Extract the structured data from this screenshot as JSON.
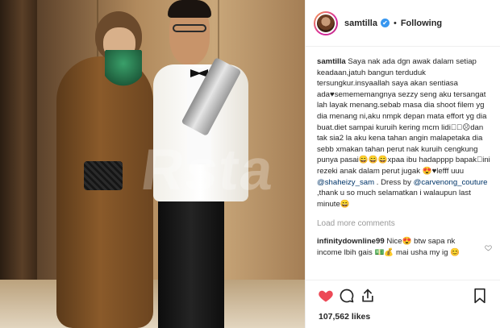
{
  "photo": {
    "watermark": "Rsta"
  },
  "header": {
    "username": "samtilla",
    "verified_mark": "✔",
    "separator": "•",
    "follow_label": "Following"
  },
  "caption": {
    "username": "samtilla",
    "text_before_mention": "Saya nak ada dgn awak dalam setiap keadaan,jatuh bangun terduduk tersungkur.insyaallah saya akan sentiasa ada♥semememangnya sezzy seng aku tersangat lah layak menang.sebab masa dia shoot filem yg dia menang ni,aku nmpk depan mata effort yg dia buat.diet sampai kuruih kering mcm lidi⃝⃝☹dan tak sia2 la aku kena tahan angin malapetaka dia sebb xmakan tahan perut nak kuruih cengkung punya pasai😄😄😄xpaa ibu hadapppp bapak⃝ini rezeki anak dalam perut jugak 😍♥lefff uuu",
    "mention_1": "@shaheizy_sam",
    "text_between": ". Dress by",
    "mention_2": "@carvenong_couture",
    "text_after": ",thank u so much selamatkan i walaupun last minute😄"
  },
  "load_more_label": "Load more comments",
  "comment": {
    "username": "infinitydownline99",
    "text": "Nice😍 btw sapa nk income lbih gais 💵💰 mai usha my ig 😊"
  },
  "likes": {
    "count": "107,562 likes"
  },
  "icons": {
    "like": "heart-icon",
    "comment": "comment-icon",
    "share": "share-icon",
    "save": "bookmark-icon",
    "comment_like": "small-heart-icon"
  },
  "colors": {
    "heart_active": "#ed4956",
    "verified": "#3897f0",
    "mention": "#003569",
    "muted": "#999999"
  }
}
